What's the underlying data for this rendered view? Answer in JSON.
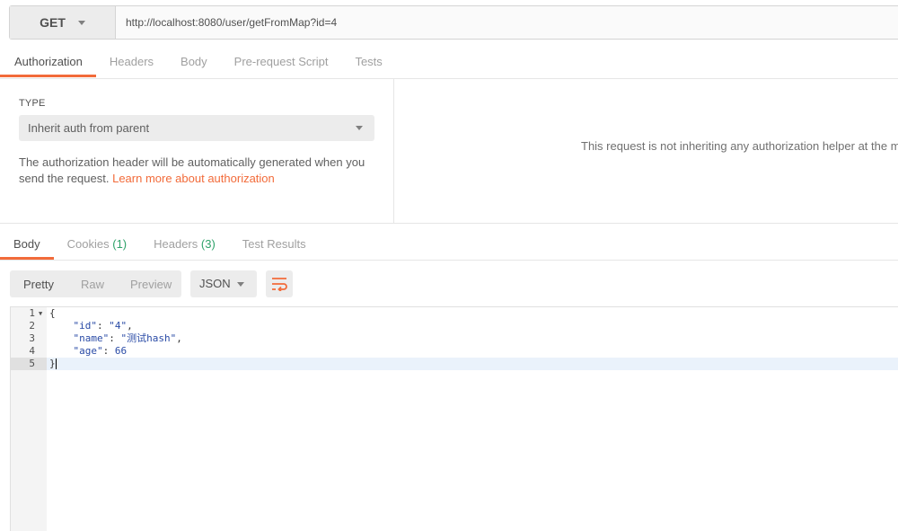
{
  "request": {
    "method": "GET",
    "url": "http://localhost:8080/user/getFromMap?id=4"
  },
  "request_tabs": [
    "Authorization",
    "Headers",
    "Body",
    "Pre-request Script",
    "Tests"
  ],
  "auth": {
    "type_label": "TYPE",
    "type_value": "Inherit auth from parent",
    "description": "The authorization header will be automatically generated when you send the request.",
    "learn_more": "Learn more about authorization",
    "right_message": "This request is not inheriting any authorization helper at the mo"
  },
  "response_tabs": {
    "body": "Body",
    "cookies": "Cookies",
    "cookies_count": "(1)",
    "headers": "Headers",
    "headers_count": "(3)",
    "test_results": "Test Results"
  },
  "view_modes": [
    "Pretty",
    "Raw",
    "Preview"
  ],
  "format": "JSON",
  "code": {
    "line_numbers": [
      "1",
      "2",
      "3",
      "4",
      "5"
    ],
    "open_brace": "{",
    "close_brace": "}",
    "key_id": "\"id\"",
    "val_id": "\"4\"",
    "key_name": "\"name\"",
    "val_name": "\"测试hash\"",
    "key_age": "\"age\"",
    "val_age": "66"
  },
  "colors": {
    "accent": "#f26b3a",
    "count": "#2fa26a",
    "json_token": "#2a4ba6"
  },
  "icons": [
    "chevron-down-icon",
    "wrap-lines-icon",
    "fold-arrow-icon"
  ]
}
